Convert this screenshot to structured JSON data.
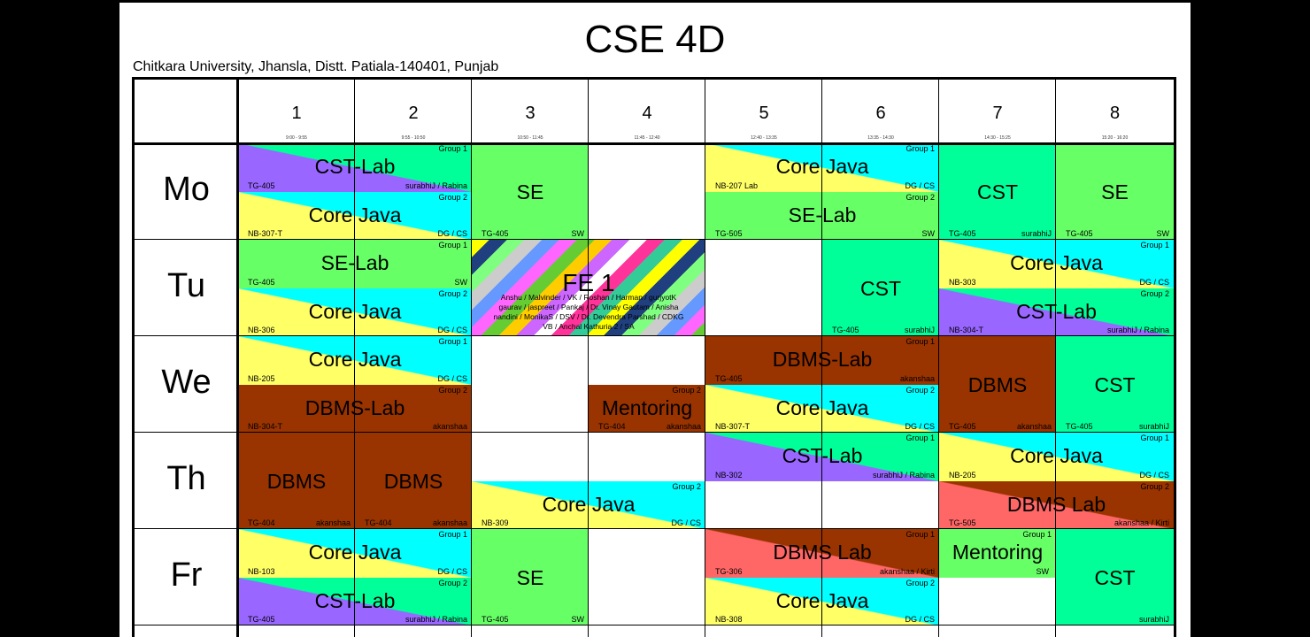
{
  "title": "CSE 4D",
  "subtitle": "Chitkara University, Jhansla, Distt. Patiala-140401, Punjab",
  "colors": {
    "green": "#66ff66",
    "cyan": "#00ffff",
    "yellow": "#ffff66",
    "purple": "#9966ff",
    "aqua_green": "#00ff99",
    "brown": "#993300",
    "red": "#ff6666"
  },
  "periods": [
    {
      "num": "1",
      "time": "9:00 - 9:55"
    },
    {
      "num": "2",
      "time": "9:55 - 10:50"
    },
    {
      "num": "3",
      "time": "10:50 - 11:45"
    },
    {
      "num": "4",
      "time": "11:45 - 12:40"
    },
    {
      "num": "5",
      "time": "12:40 - 13:35"
    },
    {
      "num": "6",
      "time": "13:35 - 14:30"
    },
    {
      "num": "7",
      "time": "14:30 - 15:25"
    },
    {
      "num": "8",
      "time": "15:20 - 16:20"
    }
  ],
  "days": [
    "Mo",
    "Tu",
    "We",
    "Th",
    "Fr"
  ],
  "classes": [
    {
      "day": 0,
      "p": 0,
      "span": 2,
      "half": "top",
      "subject": "CST-Lab",
      "group": "Group 1",
      "room": "TG-405",
      "teacher": "surabhiJ / Rabina",
      "bg": [
        "#00ff99",
        "#9966ff"
      ]
    },
    {
      "day": 0,
      "p": 0,
      "span": 2,
      "half": "bottom",
      "subject": "Core Java",
      "group": "Group 2",
      "room": "NB-307-T",
      "teacher": "DG / CS",
      "bg": [
        "#00ffff",
        "#ffff66"
      ]
    },
    {
      "day": 0,
      "p": 2,
      "span": 1,
      "half": "full",
      "subject": "SE",
      "room": "TG-405",
      "teacher": "SW",
      "bg": [
        "#66ff66"
      ]
    },
    {
      "day": 0,
      "p": 4,
      "span": 2,
      "half": "top",
      "subject": "Core Java",
      "group": "Group 1",
      "room": "NB-207 Lab",
      "teacher": "DG / CS",
      "bg": [
        "#00ffff",
        "#ffff66"
      ]
    },
    {
      "day": 0,
      "p": 4,
      "span": 2,
      "half": "bottom",
      "subject": "SE-Lab",
      "group": "Group 2",
      "room": "TG-505",
      "teacher": "SW",
      "bg": [
        "#66ff66"
      ]
    },
    {
      "day": 0,
      "p": 6,
      "span": 1,
      "half": "full",
      "subject": "CST",
      "room": "TG-405",
      "teacher": "surabhiJ",
      "bg": [
        "#00ff99"
      ]
    },
    {
      "day": 0,
      "p": 7,
      "span": 1,
      "half": "full",
      "subject": "SE",
      "room": "TG-405",
      "teacher": "SW",
      "bg": [
        "#66ff66"
      ]
    },
    {
      "day": 1,
      "p": 0,
      "span": 2,
      "half": "top",
      "subject": "SE-Lab",
      "group": "Group 1",
      "room": "TG-405",
      "teacher": "SW",
      "bg": [
        "#66ff66"
      ]
    },
    {
      "day": 1,
      "p": 0,
      "span": 2,
      "half": "bottom",
      "subject": "Core Java",
      "group": "Group 2",
      "room": "NB-306",
      "teacher": "DG / CS",
      "bg": [
        "#00ffff",
        "#ffff66"
      ]
    },
    {
      "day": 1,
      "p": 2,
      "span": 2,
      "half": "full",
      "subject": "FE 1",
      "striped": true,
      "names": [
        "Anshu / Malvinder / VK / Roshan / Harman / gurjyotK",
        "gaurav / jaspreet / Pankaj / Dr. Vinay Gautam / Anisha",
        "nandini / MonikaS / DSV / Dr. Devendra Parshad / CDKG",
        "VB / Anchal Kathuria 2  / SA"
      ]
    },
    {
      "day": 1,
      "p": 5,
      "span": 1,
      "half": "full",
      "subject": "CST",
      "room": "TG-405",
      "teacher": "surabhiJ",
      "bg": [
        "#00ff99"
      ]
    },
    {
      "day": 1,
      "p": 6,
      "span": 2,
      "half": "top",
      "subject": "Core Java",
      "group": "Group 1",
      "room": "NB-303",
      "teacher": "DG / CS",
      "bg": [
        "#00ffff",
        "#ffff66"
      ]
    },
    {
      "day": 1,
      "p": 6,
      "span": 2,
      "half": "bottom",
      "subject": "CST-Lab",
      "group": "Group 2",
      "room": "NB-304-T",
      "teacher": "surabhiJ / Rabina",
      "bg": [
        "#00ff99",
        "#9966ff"
      ]
    },
    {
      "day": 2,
      "p": 0,
      "span": 2,
      "half": "top",
      "subject": "Core Java",
      "group": "Group 1",
      "room": "NB-205",
      "teacher": "DG / CS",
      "bg": [
        "#00ffff",
        "#ffff66"
      ]
    },
    {
      "day": 2,
      "p": 0,
      "span": 2,
      "half": "bottom",
      "subject": "DBMS-Lab",
      "group": "Group 2",
      "room": "NB-304-T",
      "teacher": "akanshaa",
      "bg": [
        "#993300"
      ]
    },
    {
      "day": 2,
      "p": 3,
      "span": 1,
      "half": "bottom",
      "subject": "Mentoring",
      "group": "Group 2",
      "room": "TG-404",
      "teacher": "akanshaa",
      "bg": [
        "#993300"
      ]
    },
    {
      "day": 2,
      "p": 4,
      "span": 2,
      "half": "top",
      "subject": "DBMS-Lab",
      "group": "Group 1",
      "room": "TG-405",
      "teacher": "akanshaa",
      "bg": [
        "#993300"
      ]
    },
    {
      "day": 2,
      "p": 4,
      "span": 2,
      "half": "bottom",
      "subject": "Core Java",
      "group": "Group 2",
      "room": "NB-307-T",
      "teacher": "DG / CS",
      "bg": [
        "#00ffff",
        "#ffff66"
      ]
    },
    {
      "day": 2,
      "p": 6,
      "span": 1,
      "half": "full",
      "subject": "DBMS",
      "room": "TG-405",
      "teacher": "akanshaa",
      "bg": [
        "#993300"
      ]
    },
    {
      "day": 2,
      "p": 7,
      "span": 1,
      "half": "full",
      "subject": "CST",
      "room": "TG-405",
      "teacher": "surabhiJ",
      "bg": [
        "#00ff99"
      ]
    },
    {
      "day": 3,
      "p": 0,
      "span": 1,
      "half": "full",
      "subject": "DBMS",
      "room": "TG-404",
      "teacher": "akanshaa",
      "bg": [
        "#993300"
      ]
    },
    {
      "day": 3,
      "p": 1,
      "span": 1,
      "half": "full",
      "subject": "DBMS",
      "room": "TG-404",
      "teacher": "akanshaa",
      "bg": [
        "#993300"
      ]
    },
    {
      "day": 3,
      "p": 2,
      "span": 2,
      "half": "bottom",
      "subject": "Core Java",
      "group": "Group 2",
      "room": "NB-309",
      "teacher": "DG / CS",
      "bg": [
        "#00ffff",
        "#ffff66"
      ]
    },
    {
      "day": 3,
      "p": 4,
      "span": 2,
      "half": "top",
      "subject": "CST-Lab",
      "group": "Group 1",
      "room": "NB-302",
      "teacher": "surabhiJ / Rabina",
      "bg": [
        "#00ff99",
        "#9966ff"
      ]
    },
    {
      "day": 3,
      "p": 6,
      "span": 2,
      "half": "top",
      "subject": "Core Java",
      "group": "Group 1",
      "room": "NB-205",
      "teacher": "DG / CS",
      "bg": [
        "#00ffff",
        "#ffff66"
      ]
    },
    {
      "day": 3,
      "p": 6,
      "span": 2,
      "half": "bottom",
      "subject": "DBMS Lab",
      "group": "Group 2",
      "room": "TG-505",
      "teacher": "akanshaa / Kirti",
      "bg": [
        "#993300",
        "#ff6666"
      ]
    },
    {
      "day": 4,
      "p": 0,
      "span": 2,
      "half": "top",
      "subject": "Core Java",
      "group": "Group 1",
      "room": "NB-103",
      "teacher": "DG / CS",
      "bg": [
        "#00ffff",
        "#ffff66"
      ]
    },
    {
      "day": 4,
      "p": 0,
      "span": 2,
      "half": "bottom",
      "subject": "CST-Lab",
      "group": "Group 2",
      "room": "TG-405",
      "teacher": "surabhiJ / Rabina",
      "bg": [
        "#00ff99",
        "#9966ff"
      ]
    },
    {
      "day": 4,
      "p": 2,
      "span": 1,
      "half": "full",
      "subject": "SE",
      "room": "TG-405",
      "teacher": "SW",
      "bg": [
        "#66ff66"
      ]
    },
    {
      "day": 4,
      "p": 4,
      "span": 2,
      "half": "top",
      "subject": "DBMS Lab",
      "group": "Group 1",
      "room": "TG-306",
      "teacher": "akanshaa / Kirti",
      "bg": [
        "#993300",
        "#ff6666"
      ]
    },
    {
      "day": 4,
      "p": 4,
      "span": 2,
      "half": "bottom",
      "subject": "Core Java",
      "group": "Group 2",
      "room": "NB-308",
      "teacher": "DG / CS",
      "bg": [
        "#00ffff",
        "#ffff66"
      ]
    },
    {
      "day": 4,
      "p": 6,
      "span": 1,
      "half": "top",
      "subject": "Mentoring",
      "group": "Group 1",
      "teacher": "SW",
      "bg": [
        "#66ff66"
      ]
    },
    {
      "day": 4,
      "p": 7,
      "span": 1,
      "half": "full",
      "subject": "CST",
      "teacher": "surabhiJ",
      "bg": [
        "#00ff99"
      ]
    }
  ]
}
